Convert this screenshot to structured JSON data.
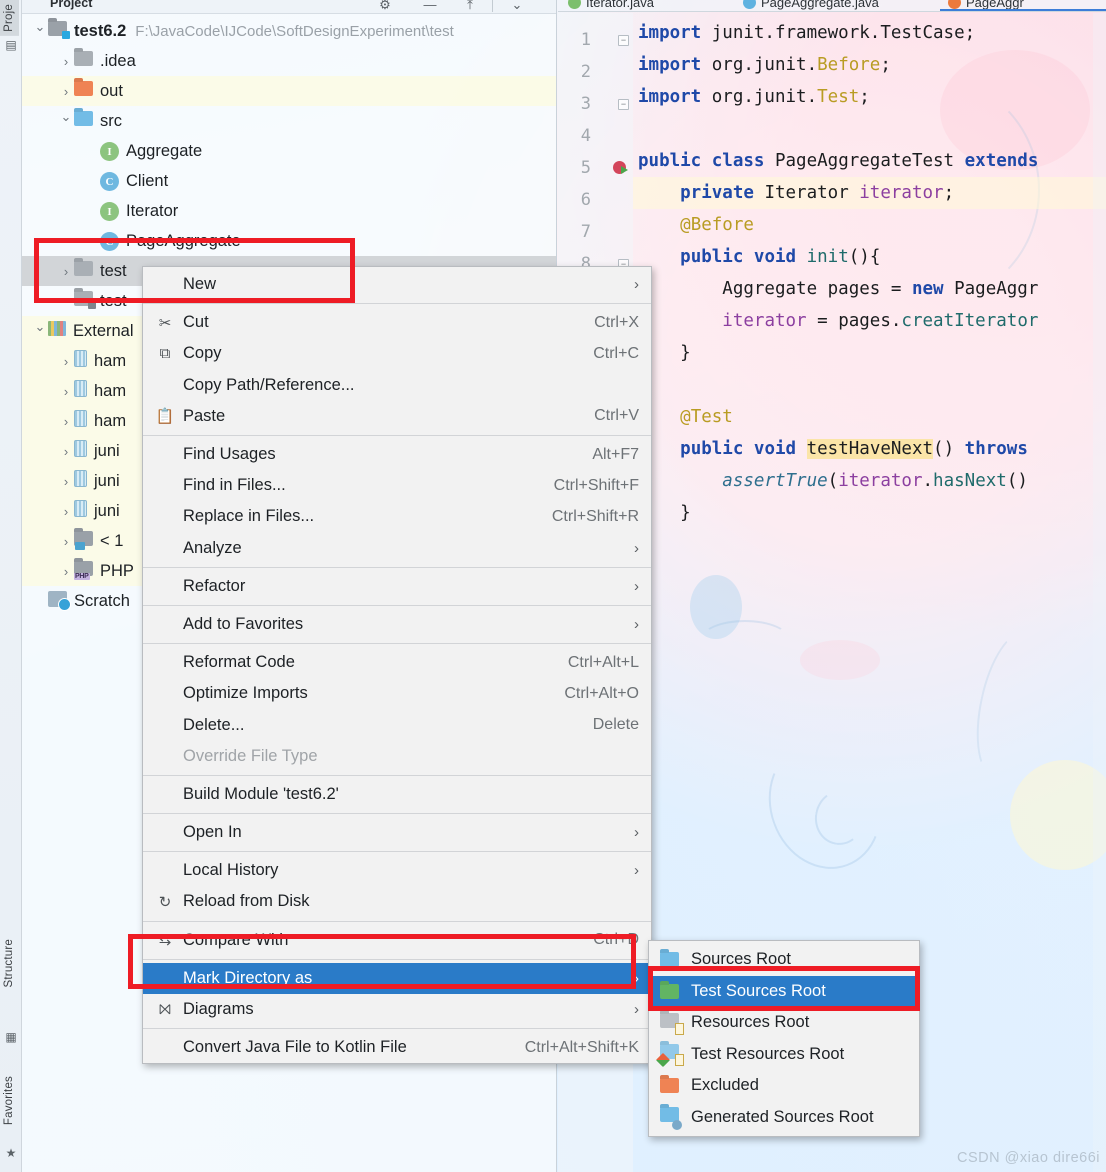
{
  "tool_strip": {
    "project_tab": "Proje",
    "structure_tab": "Structure",
    "favorites_tab": "Favorites"
  },
  "project_panel": {
    "title": "Project",
    "header_icons": [
      "gear-icon",
      "minimize-icon",
      "collapse-icon",
      "chevron-down-icon"
    ],
    "tree": [
      {
        "label": "test6.2",
        "path": "F:\\JavaCode\\IJCode\\SoftDesignExperiment\\test",
        "icon": "module-folder-icon",
        "chevron": "open",
        "indent": 0,
        "bold": true
      },
      {
        "label": ".idea",
        "path": "",
        "icon": "folder-gray-icon",
        "chevron": "closed",
        "indent": 1,
        "bold": false
      },
      {
        "label": "out",
        "path": "",
        "icon": "folder-orange-icon",
        "chevron": "closed",
        "indent": 1,
        "bold": false
      },
      {
        "label": "src",
        "path": "",
        "icon": "folder-blue-icon",
        "chevron": "open",
        "indent": 1,
        "bold": false
      },
      {
        "label": "Aggregate",
        "path": "",
        "icon": "interface-icon",
        "chevron": "none",
        "indent": 2,
        "bold": false
      },
      {
        "label": "Client",
        "path": "",
        "icon": "class-icon",
        "chevron": "none",
        "indent": 2,
        "bold": false
      },
      {
        "label": "Iterator",
        "path": "",
        "icon": "interface-icon",
        "chevron": "none",
        "indent": 2,
        "bold": false
      },
      {
        "label": "PageAggregate",
        "path": "",
        "icon": "class-icon",
        "chevron": "none",
        "indent": 2,
        "bold": false
      },
      {
        "label": "test",
        "path": "",
        "icon": "folder-gray-icon",
        "chevron": "closed",
        "indent": 1,
        "bold": false
      },
      {
        "label": "test",
        "path": "",
        "icon": "module-file-icon",
        "chevron": "none",
        "indent": 1,
        "bold": false
      },
      {
        "label": "External",
        "path": "",
        "icon": "external-libraries-icon",
        "chevron": "open",
        "indent": 0,
        "bold": false
      },
      {
        "label": "ham",
        "path": "",
        "icon": "jar-icon",
        "chevron": "closed",
        "indent": 1,
        "bold": false
      },
      {
        "label": "ham",
        "path": "",
        "icon": "jar-icon",
        "chevron": "closed",
        "indent": 1,
        "bold": false
      },
      {
        "label": "ham",
        "path": "",
        "icon": "jar-icon",
        "chevron": "closed",
        "indent": 1,
        "bold": false
      },
      {
        "label": "juni",
        "path": "",
        "icon": "jar-icon",
        "chevron": "closed",
        "indent": 1,
        "bold": false
      },
      {
        "label": "juni",
        "path": "",
        "icon": "jar-icon",
        "chevron": "closed",
        "indent": 1,
        "bold": false
      },
      {
        "label": "juni",
        "path": "",
        "icon": "jar-icon",
        "chevron": "closed",
        "indent": 1,
        "bold": false
      },
      {
        "label": "< 1",
        "path": "",
        "icon": "jdk-folder-icon",
        "chevron": "closed",
        "indent": 1,
        "bold": false
      },
      {
        "label": "PHP",
        "path": "",
        "icon": "php-folder-icon",
        "chevron": "closed",
        "indent": 1,
        "bold": false
      },
      {
        "label": "Scratch",
        "path": "",
        "icon": "scratches-icon",
        "chevron": "none",
        "indent": 0,
        "bold": false
      }
    ],
    "selected_row_index": 8
  },
  "editor": {
    "tabs": [
      {
        "label": "Iterator.java",
        "icon": "interface-file-icon",
        "active": false
      },
      {
        "label": "PageAggregate.java",
        "icon": "class-file-icon",
        "active": false
      },
      {
        "label": "PageAggr",
        "icon": "test-class-file-icon",
        "active": true
      }
    ],
    "line_numbers": [
      "1",
      "2",
      "3",
      "4",
      "5",
      "6",
      "7",
      "8"
    ],
    "code_lines": [
      "import junit.framework.TestCase;",
      "import org.junit.Before;",
      "import org.junit.Test;",
      "",
      "public class PageAggregateTest extends",
      "    private Iterator iterator;",
      "    @Before",
      "    public void init(){",
      "        Aggregate pages = new PageAggr",
      "        iterator = pages.creatIterator",
      "    }",
      "",
      "    @Test",
      "    public void testHaveNext() throws",
      "        assertTrue(iterator.hasNext()",
      "    }",
      "}"
    ],
    "highlighted_method": "testHaveNext"
  },
  "context_menu": {
    "items": [
      {
        "label": "New",
        "shortcut": "",
        "submenu": true,
        "icon": "",
        "disabled": false,
        "selected": false,
        "sep_after": true
      },
      {
        "label": "Cut",
        "shortcut": "Ctrl+X",
        "submenu": false,
        "icon": "scissors-icon",
        "disabled": false,
        "selected": false,
        "sep_after": false
      },
      {
        "label": "Copy",
        "shortcut": "Ctrl+C",
        "submenu": false,
        "icon": "copy-icon",
        "disabled": false,
        "selected": false,
        "sep_after": false
      },
      {
        "label": "Copy Path/Reference...",
        "shortcut": "",
        "submenu": false,
        "icon": "",
        "disabled": false,
        "selected": false,
        "sep_after": false
      },
      {
        "label": "Paste",
        "shortcut": "Ctrl+V",
        "submenu": false,
        "icon": "clipboard-icon",
        "disabled": false,
        "selected": false,
        "sep_after": true
      },
      {
        "label": "Find Usages",
        "shortcut": "Alt+F7",
        "submenu": false,
        "icon": "",
        "disabled": false,
        "selected": false,
        "sep_after": false
      },
      {
        "label": "Find in Files...",
        "shortcut": "Ctrl+Shift+F",
        "submenu": false,
        "icon": "",
        "disabled": false,
        "selected": false,
        "sep_after": false
      },
      {
        "label": "Replace in Files...",
        "shortcut": "Ctrl+Shift+R",
        "submenu": false,
        "icon": "",
        "disabled": false,
        "selected": false,
        "sep_after": false
      },
      {
        "label": "Analyze",
        "shortcut": "",
        "submenu": true,
        "icon": "",
        "disabled": false,
        "selected": false,
        "sep_after": true
      },
      {
        "label": "Refactor",
        "shortcut": "",
        "submenu": true,
        "icon": "",
        "disabled": false,
        "selected": false,
        "sep_after": true
      },
      {
        "label": "Add to Favorites",
        "shortcut": "",
        "submenu": true,
        "icon": "",
        "disabled": false,
        "selected": false,
        "sep_after": true
      },
      {
        "label": "Reformat Code",
        "shortcut": "Ctrl+Alt+L",
        "submenu": false,
        "icon": "",
        "disabled": false,
        "selected": false,
        "sep_after": false
      },
      {
        "label": "Optimize Imports",
        "shortcut": "Ctrl+Alt+O",
        "submenu": false,
        "icon": "",
        "disabled": false,
        "selected": false,
        "sep_after": false
      },
      {
        "label": "Delete...",
        "shortcut": "Delete",
        "submenu": false,
        "icon": "",
        "disabled": false,
        "selected": false,
        "sep_after": false
      },
      {
        "label": "Override File Type",
        "shortcut": "",
        "submenu": false,
        "icon": "",
        "disabled": true,
        "selected": false,
        "sep_after": true
      },
      {
        "label": "Build Module 'test6.2'",
        "shortcut": "",
        "submenu": false,
        "icon": "",
        "disabled": false,
        "selected": false,
        "sep_after": true
      },
      {
        "label": "Open In",
        "shortcut": "",
        "submenu": true,
        "icon": "",
        "disabled": false,
        "selected": false,
        "sep_after": true
      },
      {
        "label": "Local History",
        "shortcut": "",
        "submenu": true,
        "icon": "",
        "disabled": false,
        "selected": false,
        "sep_after": false
      },
      {
        "label": "Reload from Disk",
        "shortcut": "",
        "submenu": false,
        "icon": "refresh-icon",
        "disabled": false,
        "selected": false,
        "sep_after": true
      },
      {
        "label": "Compare With",
        "shortcut": "Ctrl+D",
        "submenu": false,
        "icon": "compare-icon",
        "disabled": false,
        "selected": false,
        "sep_after": true
      },
      {
        "label": "Mark Directory as",
        "shortcut": "",
        "submenu": true,
        "icon": "",
        "disabled": false,
        "selected": true,
        "sep_after": false
      },
      {
        "label": "Diagrams",
        "shortcut": "",
        "submenu": true,
        "icon": "diagram-icon",
        "disabled": false,
        "selected": false,
        "sep_after": true
      },
      {
        "label": "Convert Java File to Kotlin File",
        "shortcut": "Ctrl+Alt+Shift+K",
        "submenu": false,
        "icon": "",
        "disabled": false,
        "selected": false,
        "sep_after": false
      }
    ]
  },
  "submenu": {
    "items": [
      {
        "label": "Sources Root",
        "icon": "folder-blue-icon",
        "selected": false
      },
      {
        "label": "Test Sources Root",
        "icon": "folder-green-icon",
        "selected": true
      },
      {
        "label": "Resources Root",
        "icon": "resources-folder-icon",
        "selected": false
      },
      {
        "label": "Test Resources Root",
        "icon": "test-resources-folder-icon",
        "selected": false
      },
      {
        "label": "Excluded",
        "icon": "folder-orange-icon",
        "selected": false
      },
      {
        "label": "Generated Sources Root",
        "icon": "generated-folder-icon",
        "selected": false
      }
    ]
  },
  "annotations": {
    "highlight_color": "#ee1c25",
    "selection_color": "#2a7bc8",
    "boxes": [
      "tree-test-folder",
      "mark-directory-as",
      "test-sources-root"
    ]
  },
  "watermark": {
    "text": "CSDN @xiao dire66i"
  }
}
